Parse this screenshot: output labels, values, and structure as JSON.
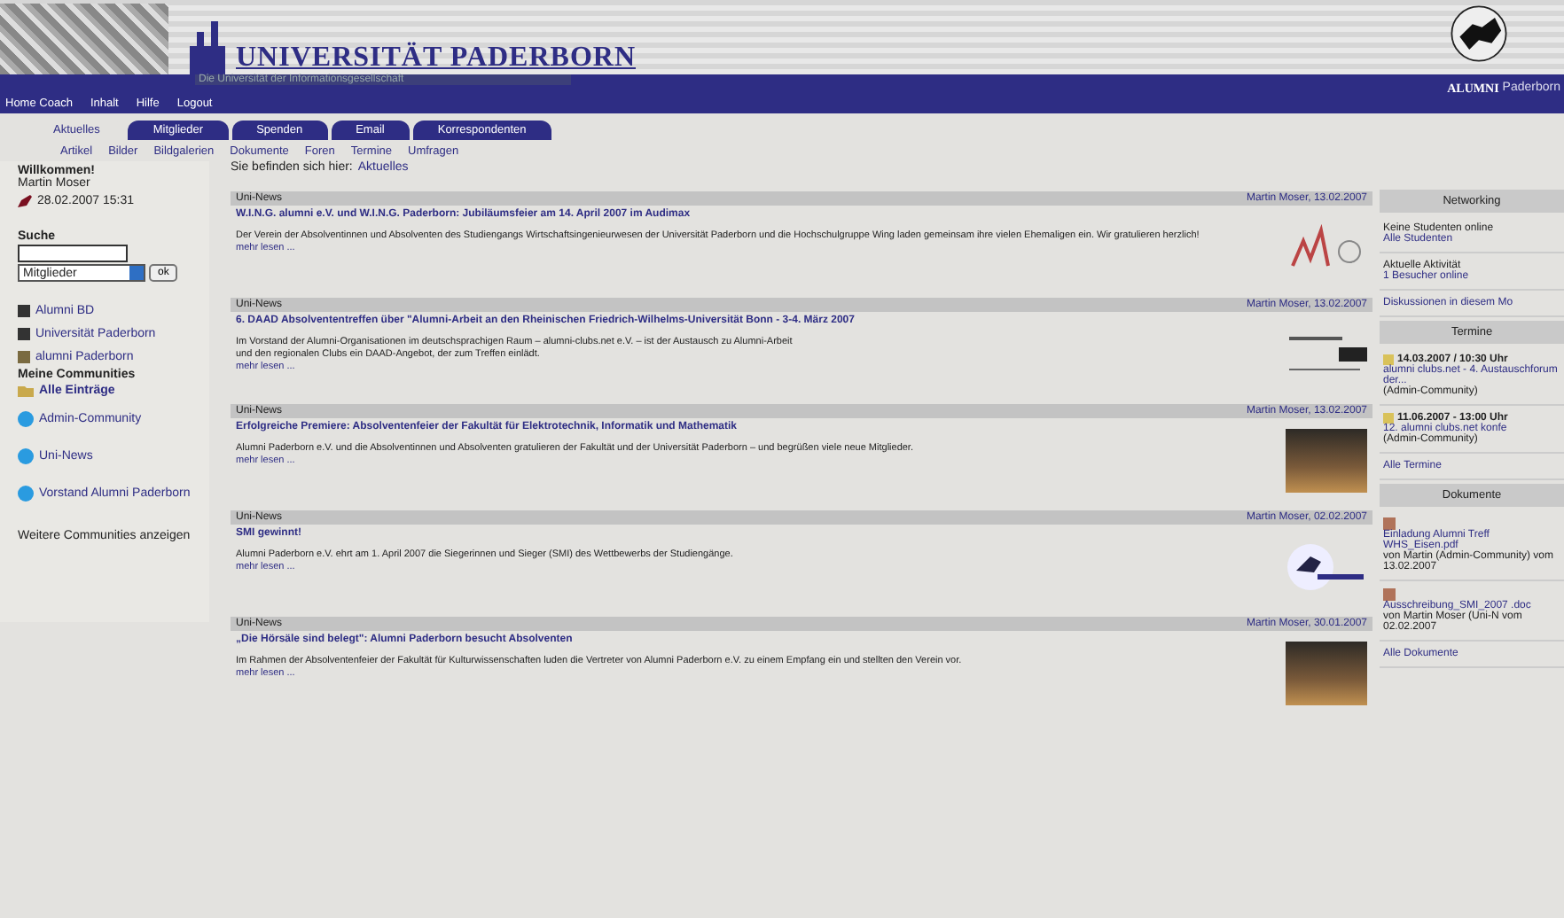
{
  "header": {
    "university": "UNIVERSITÄT PADERBORN",
    "tagline": "Die Universität der Informationsgesellschaft",
    "alumni": "ALUMNI",
    "alumni_suffix": "Paderborn"
  },
  "nav_links": [
    "Home Coach",
    "Inhalt",
    "Hilfe",
    "Logout"
  ],
  "tabs": [
    {
      "label": "Aktuelles",
      "selected": true
    },
    {
      "label": "Mitglieder",
      "selected": false
    },
    {
      "label": "Spenden",
      "selected": false
    },
    {
      "label": "Email",
      "selected": false
    },
    {
      "label": "Korrespondenten",
      "selected": false
    }
  ],
  "subnav": [
    "Artikel",
    "Bilder",
    "Bildgalerien",
    "Dokumente",
    "Foren",
    "Termine",
    "Umfragen"
  ],
  "sidebar": {
    "welcome": "Willkommen!",
    "user": "Martin Moser",
    "last_login": "28.02.2007 15:31",
    "search_label": "Suche",
    "search_scope": "Mitglieder",
    "search_button": "ok",
    "links": [
      "Alumni BD",
      "Universität Paderborn",
      "alumni Paderborn"
    ],
    "communities_heading": "Meine Communities",
    "communities": [
      {
        "label": "Alle Einträge",
        "kind": "folder"
      },
      {
        "label": "Admin-Community",
        "kind": "globe"
      },
      {
        "label": "Uni-News",
        "kind": "globe"
      },
      {
        "label": "Vorstand Alumni Paderborn",
        "kind": "globe"
      }
    ],
    "more": "Weitere Communities anzeigen"
  },
  "breadcrumb": {
    "prefix": "Sie befinden sich hier:",
    "current": "Aktuelles"
  },
  "news": [
    {
      "category": "Uni-News",
      "author": "Martin Moser, 13.02.2007",
      "title": "W.I.N.G. alumni e.V. und W.I.N.G. Paderborn: Jubiläumsfeier am 14. April 2007 im Audimax",
      "body": "Der Verein der Absolventinnen und Absolventen des Studiengangs Wirtschaftsingenieurwesen der Universität Paderborn und die Hochschulgruppe Wing laden gemeinsam ihre vielen Ehemaligen ein. Wir gratulieren herzlich!",
      "more": "mehr lesen ...",
      "kind": "logo"
    },
    {
      "category": "Uni-News",
      "author": "Martin Moser, 13.02.2007",
      "title": "6. DAAD Absolvententreffen über \"Alumni-Arbeit an den Rheinischen Friedrich-Wilhelms-Universität Bonn - 3-4. März 2007",
      "body": "Im Vorstand der Alumni-Organisationen im deutschsprachigen Raum – alumni-clubs.net e.V. – ist der Austausch zu Alumni-Arbeit",
      "body2": "und den regionalen Clubs ein DAAD-Angebot, der zum Treffen einlädt.",
      "more": "mehr lesen ...",
      "kind": "banner"
    },
    {
      "category": "Uni-News",
      "author": "Martin Moser, 13.02.2007",
      "title": "Erfolgreiche Premiere: Absolventenfeier der Fakultät für Elektrotechnik, Informatik und Mathematik",
      "body": "Alumni Paderborn e.V. und die Absolventinnen und Absolventen gratulieren der Fakultät und der Universität Paderborn – und begrüßen viele neue Mitglieder.",
      "more": "mehr lesen ...",
      "kind": "photo"
    },
    {
      "category": "Uni-News",
      "author": "Martin Moser, 02.02.2007",
      "title": "SMI gewinnt!",
      "body": "Alumni Paderborn e.V. ehrt am 1. April 2007 die Siegerinnen und Sieger (SMI) des Wettbewerbs der Studiengänge.",
      "more": "mehr lesen ...",
      "kind": "logo2"
    },
    {
      "category": "Uni-News",
      "author": "Martin Moser, 30.01.2007",
      "title": "„Die Hörsäle sind belegt\": Alumni Paderborn besucht Absolventen",
      "body": "Im Rahmen der Absolventenfeier der Fakultät für Kulturwissenschaften luden die Vertreter von Alumni Paderborn e.V. zu einem Empfang ein und stellten den Verein vor.",
      "more": "mehr lesen ...",
      "kind": "photo"
    }
  ],
  "right_panels": [
    {
      "title": "Networking",
      "entries": [
        {
          "text": "Keine Studenten online",
          "link": "Alle Studenten"
        },
        {
          "text": "Aktuelle Aktivität",
          "link": "1 Besucher online"
        },
        {
          "link": "Diskussionen in diesem Mo"
        }
      ]
    },
    {
      "title": "Termine",
      "entries": [
        {
          "date": "14.03.2007 / 10:30 Uhr",
          "link": "alumni clubs.net - 4. Austauschforum der...",
          "text": "(Admin-Community)"
        },
        {
          "date": "11.06.2007 - 13:00 Uhr",
          "link": "12. alumni clubs.net konfe",
          "text": "(Admin-Community)"
        },
        {
          "link": "Alle Termine"
        }
      ]
    },
    {
      "title": "Dokumente",
      "entries": [
        {
          "link": "Einladung Alumni Treff WHS_Eisen.pdf",
          "text": "von Martin (Admin-Community) vom 13.02.2007"
        },
        {
          "link": "Ausschreibung_SMI_2007 .doc",
          "text": "von Martin Moser (Uni-N vom 02.02.2007"
        },
        {
          "link": "Alle Dokumente"
        }
      ]
    }
  ]
}
